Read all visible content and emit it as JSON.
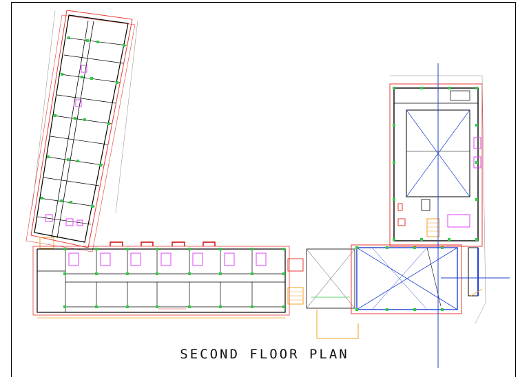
{
  "drawing": {
    "title": "SECOND FLOOR PLAN"
  },
  "colors": {
    "background": "#ffffff",
    "wall": "#000000",
    "outline_red": "#e53935",
    "column_green": "#2ecc40",
    "fixture_magenta": "#e040fb",
    "axis_blue": "#1e3fd6",
    "slab_orange": "#f0a020",
    "dim_gray": "#8a8a8a"
  }
}
